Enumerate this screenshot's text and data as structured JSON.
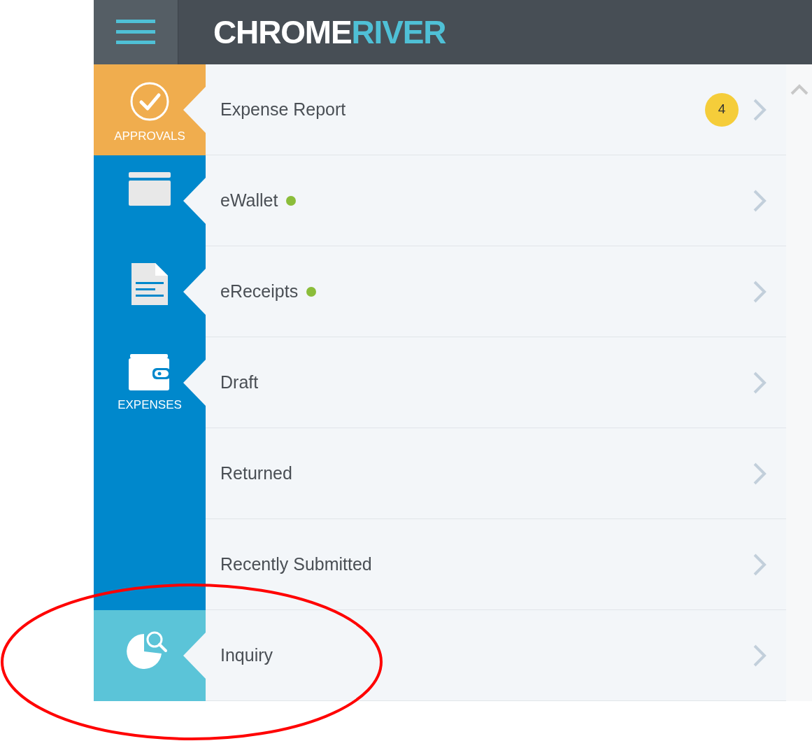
{
  "header": {
    "logo": {
      "first": "CHROME",
      "second": "RIVER"
    }
  },
  "sections": [
    {
      "color": "#f0ad4e",
      "rows": [
        {
          "kind": "check",
          "section_label": "APPROVALS",
          "label": "Expense Report",
          "dot": false,
          "badge": "4"
        }
      ]
    },
    {
      "color": "#0088cc",
      "rows": [
        {
          "kind": "card",
          "label": "eWallet",
          "dot": true
        },
        {
          "kind": "document",
          "label": "eReceipts",
          "dot": true
        },
        {
          "kind": "wallet",
          "section_label": "EXPENSES",
          "label": "Draft",
          "dot": false
        },
        {
          "label": "Returned",
          "dot": false
        },
        {
          "label": "Recently Submitted",
          "dot": false
        }
      ]
    },
    {
      "color": "#5bc4d8",
      "rows": [
        {
          "kind": "inquiry",
          "label": "Inquiry",
          "dot": false
        }
      ]
    }
  ]
}
